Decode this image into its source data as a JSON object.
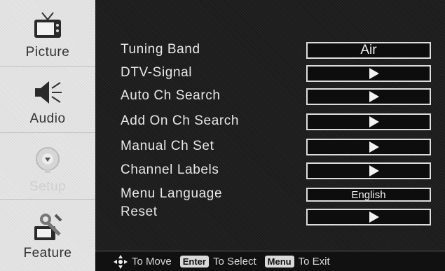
{
  "sidebar": {
    "items": [
      {
        "label": "Picture",
        "icon": "tv-icon"
      },
      {
        "label": "Audio",
        "icon": "speaker-icon"
      },
      {
        "label": "Setup",
        "icon": "dish-icon"
      },
      {
        "label": "Feature",
        "icon": "tools-icon"
      }
    ]
  },
  "menu": {
    "rows": [
      {
        "label": "Tuning Band",
        "value": "Air"
      },
      {
        "label": "DTV-Signal"
      },
      {
        "label": "Auto Ch Search"
      },
      {
        "label": "Add On Ch Search"
      },
      {
        "label": "Manual Ch Set"
      },
      {
        "label": "Channel Labels"
      },
      {
        "label": "Menu Language",
        "value": "English"
      },
      {
        "label": "Reset"
      }
    ]
  },
  "help": {
    "move": "To Move",
    "enter_key": "Enter",
    "select": "To Select",
    "menu_key": "Menu",
    "exit": "To Exit"
  }
}
